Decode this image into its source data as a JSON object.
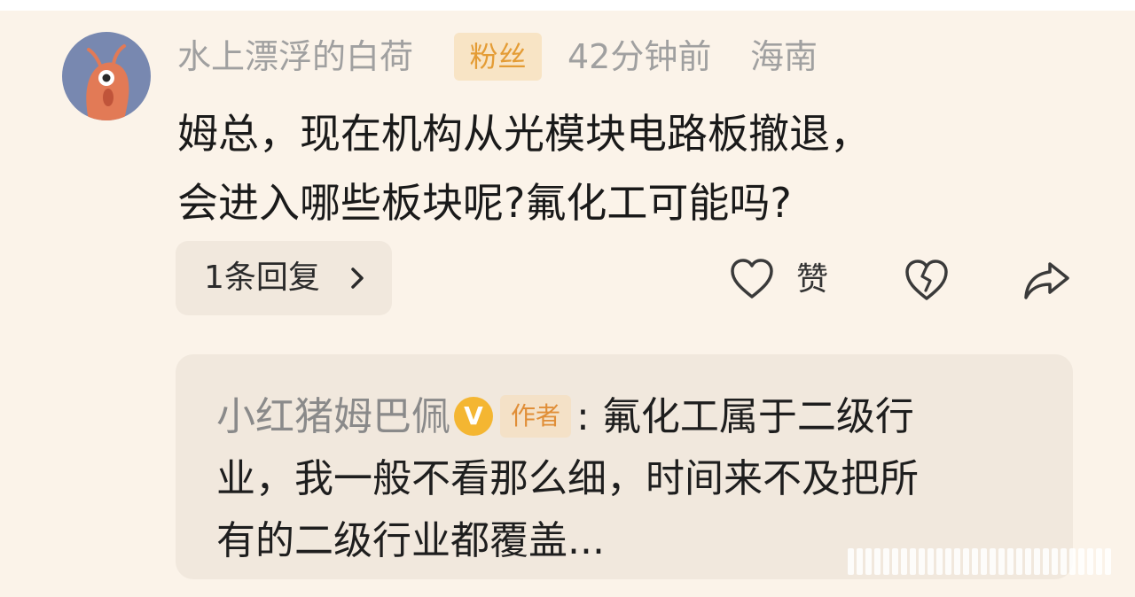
{
  "comment": {
    "username": "水上漂浮的白荷",
    "fan_badge": "粉丝",
    "time": "42分钟前",
    "location": "海南",
    "text_line1": "姆总，现在机构从光模块电路板撤退，",
    "text_line2": "会进入哪些板块呢?氟化工可能吗?"
  },
  "actions": {
    "reply_count_label": "1条回复",
    "like_label": "赞"
  },
  "reply": {
    "author": "小红猪姆巴佩",
    "verified_mark": "V",
    "author_tag": "作者",
    "line1": ": 氟化工属于二级行",
    "line2": "业，我一般不看那么细，时间来不及把所",
    "line3": "有的二级行业都覆盖..."
  },
  "icons": {
    "avatar": "shrimp-avatar",
    "reply_chevron": "chevron-right-icon",
    "like": "heart-icon",
    "dislike": "broken-heart-icon",
    "share": "share-icon",
    "verified": "verified-badge-icon"
  },
  "colors": {
    "background": "#fbf3e9",
    "muted_text": "#a0a0a0",
    "fan_badge_text": "#e49c35",
    "verified_badge": "#f4b632",
    "reply_box": "#f1e8dd"
  }
}
